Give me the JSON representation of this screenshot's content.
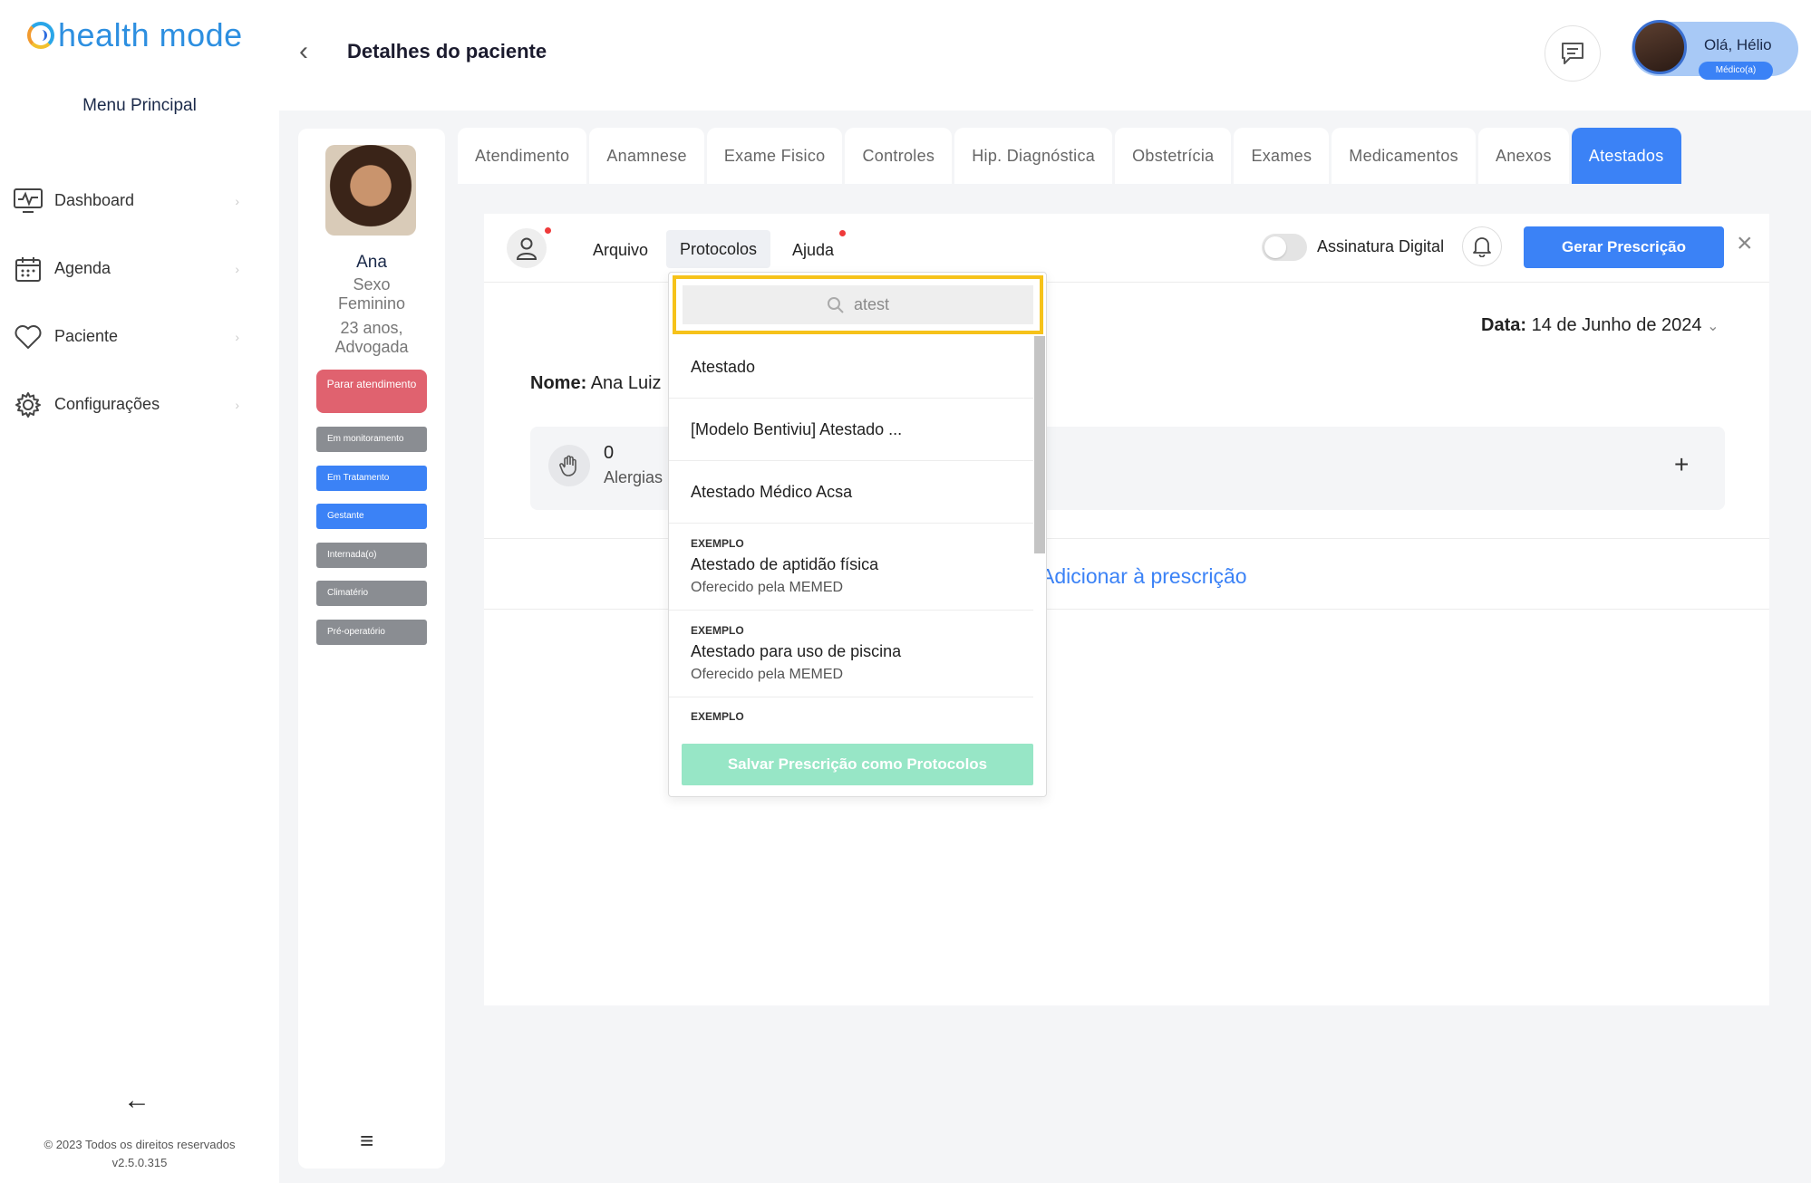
{
  "app": {
    "logo_text": "health mode"
  },
  "sidebar": {
    "menu_title": "Menu Principal",
    "items": [
      {
        "label": "Dashboard",
        "icon": "monitor-icon"
      },
      {
        "label": "Agenda",
        "icon": "calendar-icon"
      },
      {
        "label": "Paciente",
        "icon": "heart-icon"
      },
      {
        "label": "Configurações",
        "icon": "gear-icon"
      }
    ],
    "copyright": "© 2023 Todos os direitos reservados",
    "version": "v2.5.0.315"
  },
  "header": {
    "title": "Detalhes do paciente",
    "user_greeting": "Olá, Hélio",
    "user_role": "Médico(a)"
  },
  "patient": {
    "name": "Ana",
    "sex_label": "Sexo",
    "sex": "Feminino",
    "age": "23 anos,",
    "profession": "Advogada",
    "stop_button": "Parar atendimento",
    "tags": [
      "Em monitoramento",
      "Em Tratamento",
      "Gestante",
      "Internada(o)",
      "Climatério",
      "Pré-operatório"
    ]
  },
  "tabs": [
    "Atendimento",
    "Anamnese",
    "Exame Fisico",
    "Controles",
    "Hip. Diagnóstica",
    "Obstetrícia",
    "Exames",
    "Medicamentos",
    "Anexos",
    "Atestados"
  ],
  "active_tab": "Atestados",
  "prescription": {
    "menu": {
      "arquivo": "Arquivo",
      "protocolos": "Protocolos",
      "ajuda": "Ajuda"
    },
    "signature_label": "Assinatura Digital",
    "generate_button": "Gerar Prescrição",
    "date_label": "Data:",
    "date_value": "14 de Junho de 2024",
    "name_label": "Nome:",
    "name_value": "Ana Luiz",
    "allergies_count": "0",
    "allergies_label": "Alergias",
    "add_link": "Adicionar à prescrição"
  },
  "dropdown": {
    "search_value": "atest",
    "items": [
      {
        "title": "Atestado"
      },
      {
        "title": "[Modelo Bentiviu] Atestado ..."
      },
      {
        "title": "Atestado Médico Acsa"
      },
      {
        "kicker": "EXEMPLO",
        "title": "Atestado de aptidão física",
        "sub": "Oferecido pela MEMED"
      },
      {
        "kicker": "EXEMPLO",
        "title": "Atestado para uso de piscina",
        "sub": "Oferecido pela MEMED"
      },
      {
        "kicker": "EXEMPLO"
      }
    ],
    "save_button": "Salvar Prescrição como Protocolos"
  },
  "colors": {
    "primary": "#3b82f6",
    "danger": "#e0626f",
    "highlight": "#f6c21a",
    "save": "#97e6c6"
  }
}
